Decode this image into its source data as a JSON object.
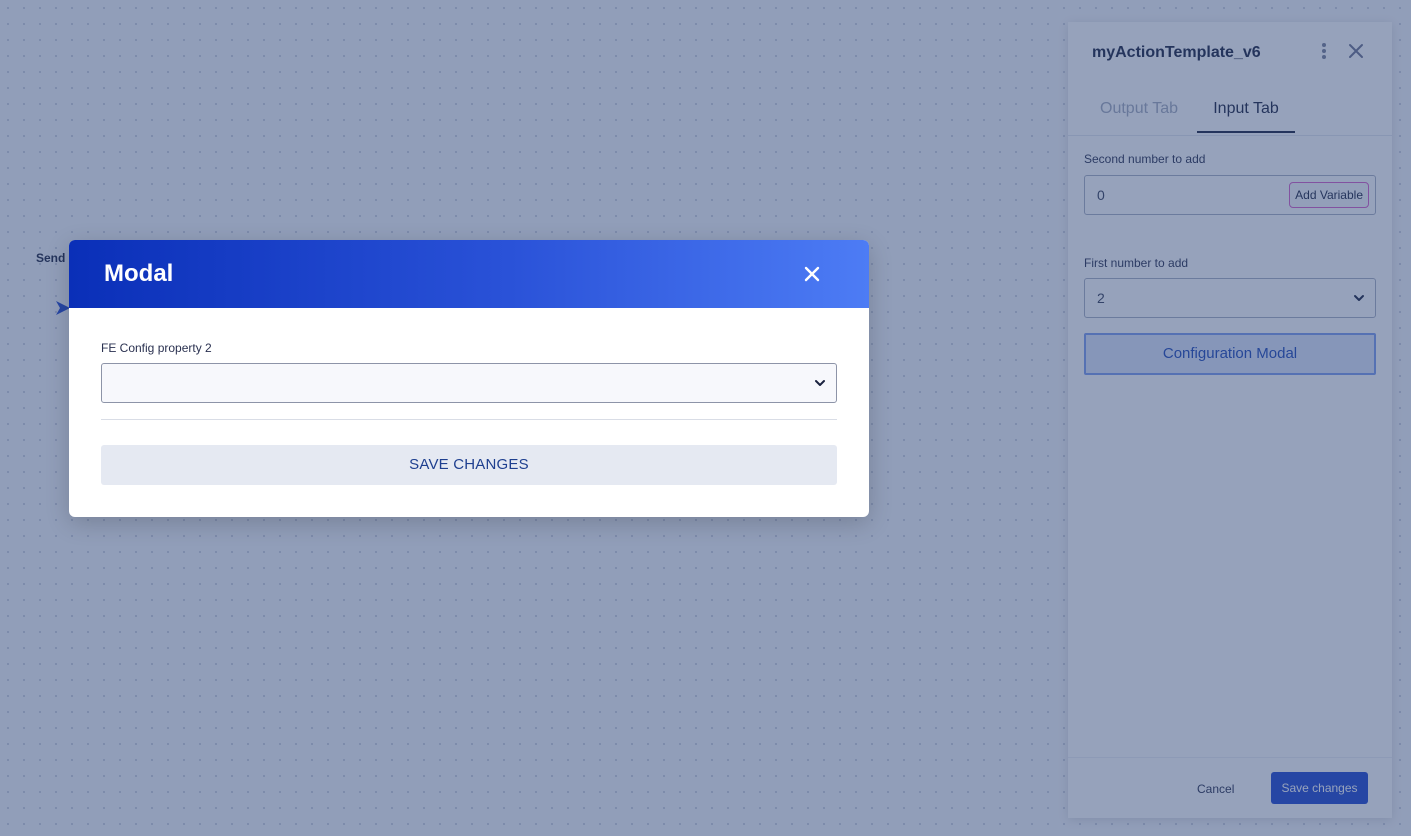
{
  "canvas": {
    "node_label": "Send E"
  },
  "panel": {
    "title": "myActionTemplate_v6",
    "tabs": [
      {
        "label": "Output Tab",
        "active": false
      },
      {
        "label": "Input Tab",
        "active": true
      }
    ],
    "fields": [
      {
        "label": "Second number to add",
        "value": "0",
        "button": "Add Variable"
      },
      {
        "label": "First number to add",
        "value": "2",
        "type": "select"
      }
    ],
    "config_button": "Configuration Modal",
    "footer": {
      "cancel": "Cancel",
      "save": "Save changes"
    }
  },
  "modal": {
    "title": "Modal",
    "field_label": "FE Config property 2",
    "field_value": "",
    "save_button": "SAVE CHANGES"
  },
  "colors": {
    "accent": "#1f46d1",
    "modal_header_start": "#0a2fb8",
    "modal_header_end": "#4d7cf5",
    "overlay": "rgba(45,70,120,0.5)"
  },
  "icons": {
    "panel_menu": "kebab-menu-icon",
    "panel_close": "close-icon",
    "modal_close": "close-icon",
    "select": "chevron-down-icon"
  }
}
